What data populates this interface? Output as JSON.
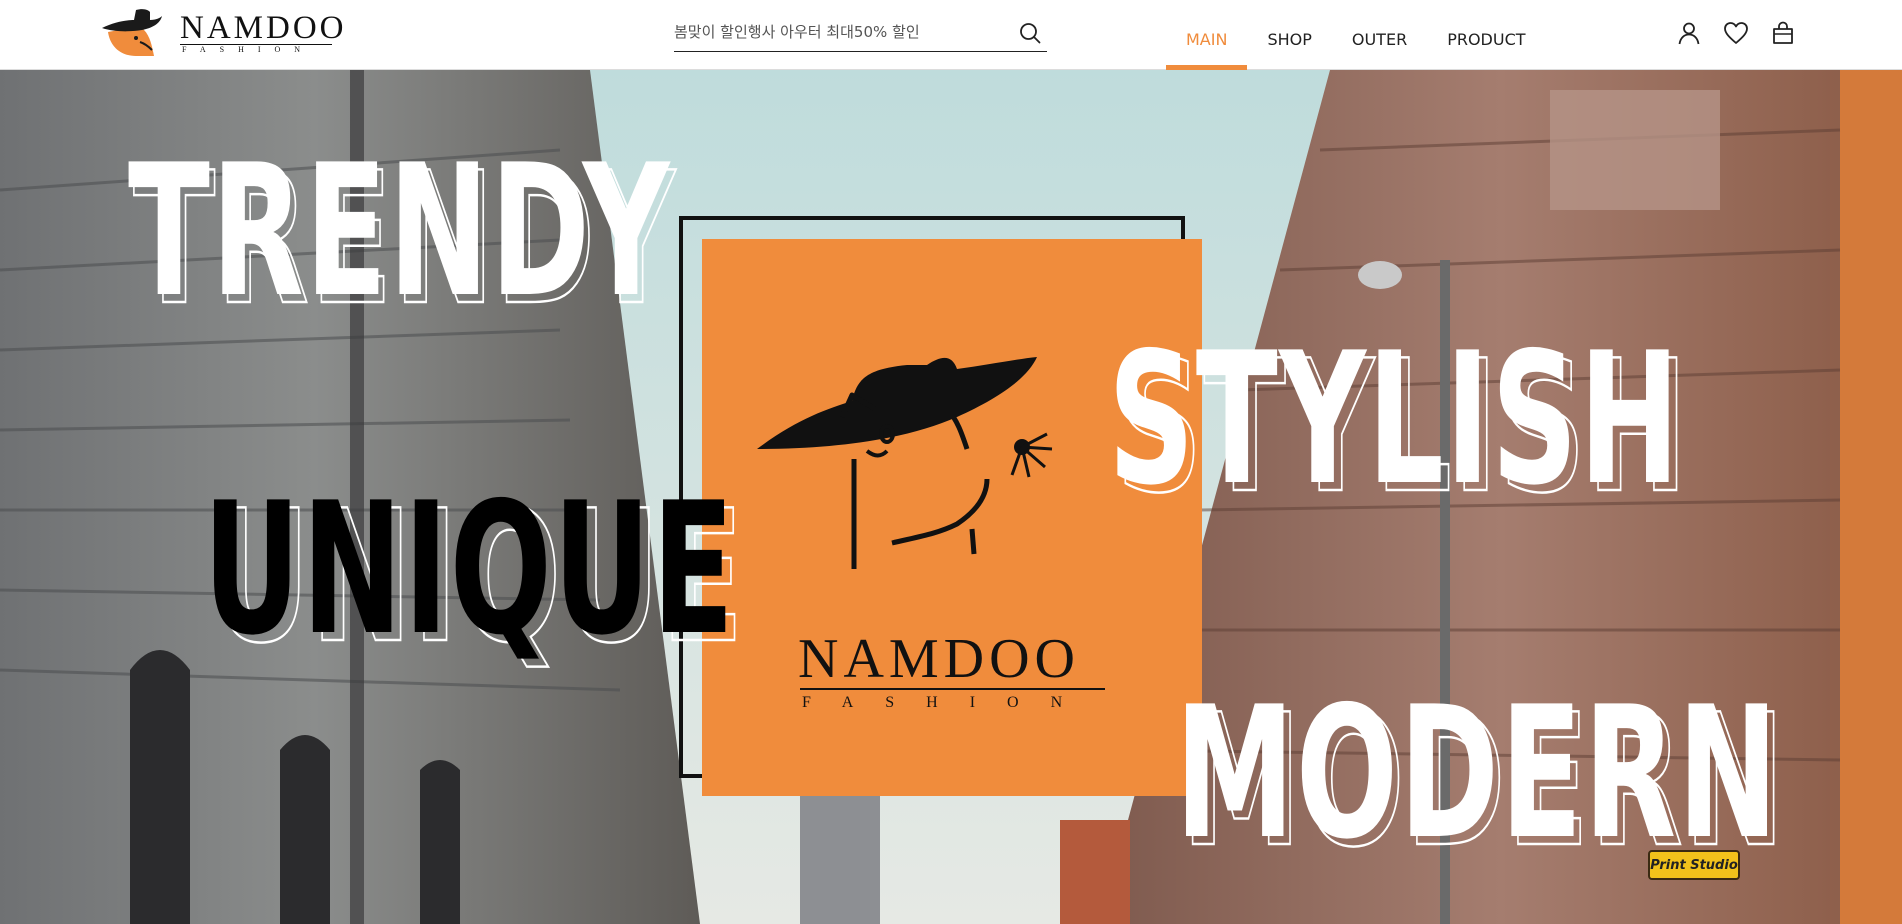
{
  "brand": {
    "name": "NAMDOO",
    "tagline": "FASHION",
    "accent_color": "#f08c3c",
    "logo_icon": "fox-with-hat-icon"
  },
  "search": {
    "placeholder": "봄맞이 할인행사 아우터 최대50% 할인",
    "value": "",
    "icon": "search-icon"
  },
  "nav": {
    "items": [
      {
        "label": "MAIN",
        "active": true
      },
      {
        "label": "SHOP",
        "active": false
      },
      {
        "label": "OUTER",
        "active": false
      },
      {
        "label": "PRODUCT",
        "active": false
      }
    ]
  },
  "header_icons": [
    "user-icon",
    "heart-icon",
    "shopping-bag-icon"
  ],
  "hero": {
    "words": {
      "trendy": "TRENDY",
      "unique": "UNIQUE",
      "stylish": "STYLISH",
      "modern": "MODERN"
    },
    "card": {
      "name": "NAMDOO",
      "tagline": "FASHION",
      "icon": "fox-with-hat-icon"
    },
    "sign_text": "Print Studio"
  }
}
